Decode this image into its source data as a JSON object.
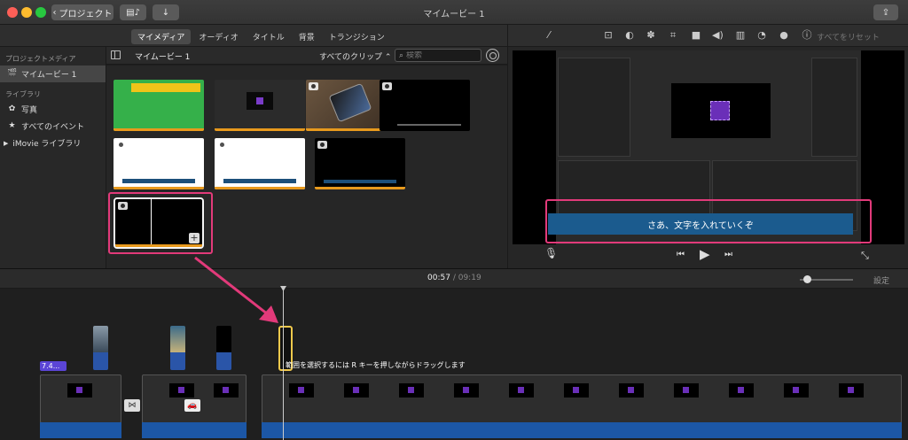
{
  "window": {
    "title": "マイムービー 1",
    "projects_button": "プロジェクト",
    "media_icon": "film-music-icon",
    "import_icon": "download-arrow-icon",
    "share_icon": "share-icon"
  },
  "tabs": [
    {
      "label": "マイメディア",
      "active": true
    },
    {
      "label": "オーディオ",
      "active": false
    },
    {
      "label": "タイトル",
      "active": false
    },
    {
      "label": "背景",
      "active": false
    },
    {
      "label": "トランジション",
      "active": false
    }
  ],
  "sidebar": {
    "project_media_header": "プロジェクトメディア",
    "project_item": "マイムービー 1",
    "library_header": "ライブラリ",
    "photos": "写真",
    "all_events": "すべてのイベント",
    "imovie_library": "iMovie ライブラリ"
  },
  "browser": {
    "title": "マイムービー 1",
    "clip_filter": "すべてのクリップ ⌃",
    "search_placeholder": "検索"
  },
  "viewer": {
    "reset_all": "すべてをリセット",
    "subtitle": "さあ、文字を入れていくぞ",
    "tools": [
      "magic-wand-icon",
      "crop-screen-icon",
      "color-balance-icon",
      "color-palette-icon",
      "crop-icon",
      "camera-icon",
      "volume-icon",
      "equalizer-icon",
      "speed-icon",
      "filter-icon",
      "info-icon"
    ]
  },
  "timeline": {
    "current_time": "00:57",
    "separator": "/",
    "total_time": "09:19",
    "settings": "設定",
    "title_clip_label": "7.4...",
    "tooltip": "範囲を選択するには R キーを押しながらドラッグします"
  },
  "colors": {
    "highlight": "#e23a7a",
    "subtitle_bg": "#1b5b8e",
    "audio": "#1c57a6",
    "selected_clip": "#f2c94c"
  }
}
